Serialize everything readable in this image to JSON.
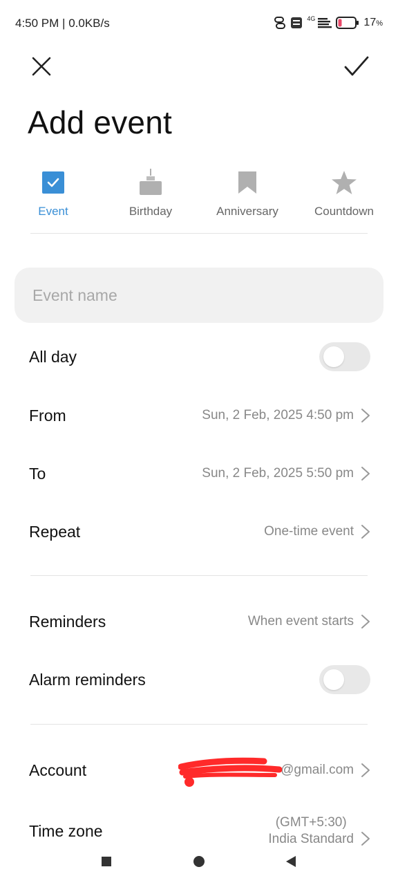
{
  "status_bar": {
    "time": "4:50 PM",
    "speed": "0.0KB/s",
    "net_label": "4G",
    "battery": "17",
    "battery_unit": "%"
  },
  "header": {
    "title": "Add event",
    "close_icon": "close-icon",
    "confirm_icon": "check-icon"
  },
  "types": [
    {
      "label": "Event",
      "icon": "checkbox-icon",
      "active": true
    },
    {
      "label": "Birthday",
      "icon": "cake-icon",
      "active": false
    },
    {
      "label": "Anniversary",
      "icon": "bookmark-icon",
      "active": false
    },
    {
      "label": "Countdown",
      "icon": "star-icon",
      "active": false
    }
  ],
  "event_name": {
    "placeholder": "Event name",
    "value": ""
  },
  "rows": {
    "all_day": {
      "label": "All day",
      "on": false
    },
    "from": {
      "label": "From",
      "value": "Sun, 2 Feb, 2025 4:50 pm"
    },
    "to": {
      "label": "To",
      "value": "Sun, 2 Feb, 2025 5:50 pm"
    },
    "repeat": {
      "label": "Repeat",
      "value": "One-time event"
    },
    "reminders": {
      "label": "Reminders",
      "value": "When event starts"
    },
    "alarm": {
      "label": "Alarm reminders",
      "on": false
    },
    "account": {
      "label": "Account",
      "value": "@gmail.com"
    },
    "timezone": {
      "label": "Time zone",
      "value_line1": "(GMT+5:30)",
      "value_line2": "India Standard"
    }
  },
  "colors": {
    "accent": "#3a8fd6",
    "redaction": "#ff2a2a"
  }
}
